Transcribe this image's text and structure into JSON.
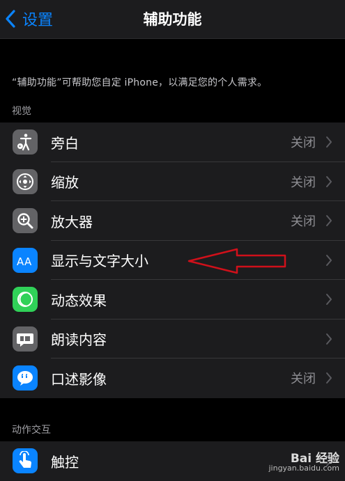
{
  "nav": {
    "back_label": "设置",
    "title": "辅助功能"
  },
  "intro_text": "“辅助功能”可帮助您自定 iPhone，以满足您的个人需求。",
  "sections": [
    {
      "header": "视觉",
      "rows": [
        {
          "label": "旁白",
          "value": "关闭",
          "icon": "voiceover-icon",
          "color": "#636366"
        },
        {
          "label": "缩放",
          "value": "关闭",
          "icon": "zoom-icon",
          "color": "#636366"
        },
        {
          "label": "放大器",
          "value": "关闭",
          "icon": "magnifier-icon",
          "color": "#636366"
        },
        {
          "label": "显示与文字大小",
          "value": "",
          "icon": "text-size-icon",
          "color": "#0a84ff"
        },
        {
          "label": "动态效果",
          "value": "",
          "icon": "motion-icon",
          "color": "#30d158"
        },
        {
          "label": "朗读内容",
          "value": "",
          "icon": "spoken-content-icon",
          "color": "#636366"
        },
        {
          "label": "口述影像",
          "value": "关闭",
          "icon": "audio-description-icon",
          "color": "#0a84ff"
        }
      ]
    },
    {
      "header": "动作交互",
      "rows": [
        {
          "label": "触控",
          "value": "",
          "icon": "touch-icon",
          "color": "#0a84ff"
        }
      ]
    }
  ],
  "watermark": {
    "line1": "Bai 经验",
    "line2": "jingyan.baidu.com"
  }
}
